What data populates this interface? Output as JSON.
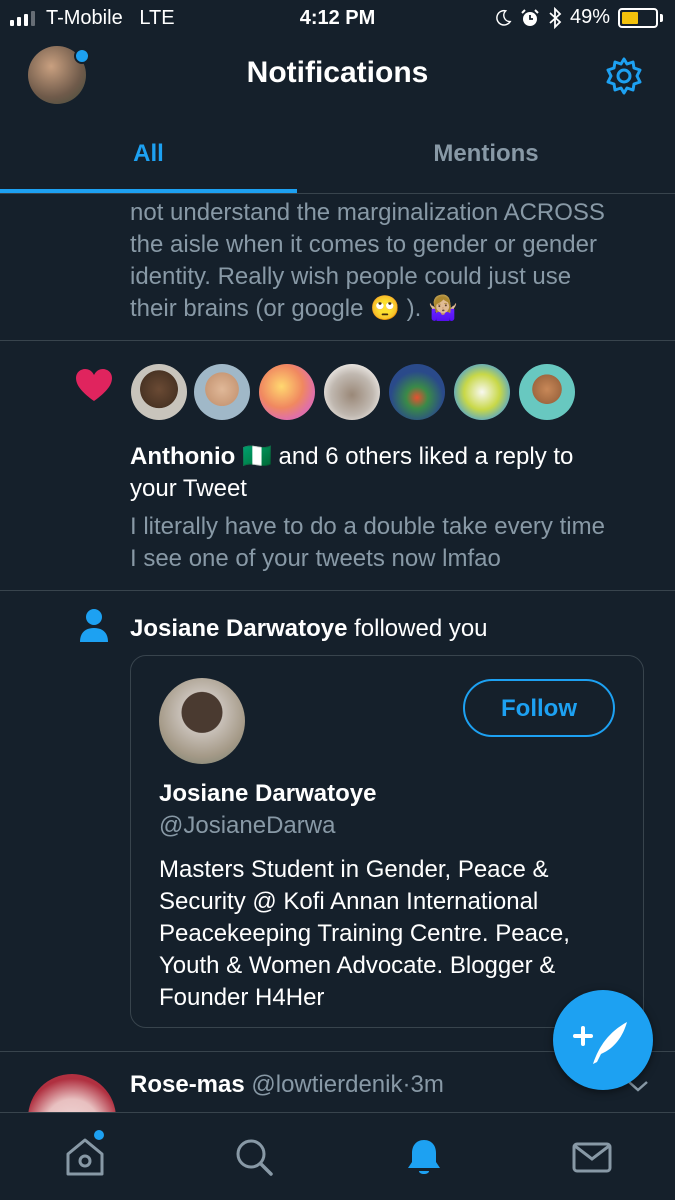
{
  "status_bar": {
    "carrier": "T-Mobile",
    "network": "LTE",
    "time": "4:12 PM",
    "battery": "49%",
    "battery_level": 0.49,
    "icons": [
      "signal-bars-icon",
      "moon-icon",
      "alarm-icon",
      "bluetooth-icon",
      "battery-icon"
    ]
  },
  "header": {
    "title": "Notifications",
    "settings_icon": "gear-icon"
  },
  "tabs": [
    {
      "label": "All",
      "active": true
    },
    {
      "label": "Mentions",
      "active": false
    }
  ],
  "notifications": {
    "first_tweet_tail": [
      "not understand the marginalization ACROSS",
      "the aisle when it comes to gender or gender",
      "identity. Really wish people could just use",
      "their brains (or google 🙄 ). 🤷🏼‍♀️"
    ],
    "like": {
      "icon": "heart-icon",
      "name": "Anthonio",
      "flag": "🇳🇬",
      "text_line1": " and 6 others liked a reply to",
      "text_line2": "your Tweet",
      "preview_line1": "I literally have to do a double take every time",
      "preview_line2": "I see one of your tweets now lmfao",
      "avatar_colors": [
        "#5a4636",
        "#c9a78a",
        "#e8a070",
        "#b8b0a8",
        "#2a4a8a",
        "#c8d848",
        "#68c8c0"
      ]
    },
    "follow": {
      "icon": "person-icon",
      "name": "Josiane Darwatoye",
      "action": " followed you",
      "card": {
        "name": "Josiane Darwatoye",
        "handle": "@JosianeDarwa",
        "follow_label": "Follow",
        "bio_lines": [
          "Masters Student in Gender, Peace &",
          "Security @ Kofi Annan International",
          "Peacekeeping Training Centre. Peace,",
          "Youth & Women Advocate. Blogger &",
          "Founder H4Her"
        ]
      }
    },
    "next": {
      "name": "Rose-mas",
      "handle": "@lowtierdenik",
      "separator": "·",
      "age": "3m"
    }
  },
  "compose_icon": "compose-tweet-icon",
  "bottom_nav": [
    {
      "name": "home-icon",
      "active": false,
      "badge": true
    },
    {
      "name": "search-icon",
      "active": false
    },
    {
      "name": "bell-icon",
      "active": true
    },
    {
      "name": "mail-icon",
      "active": false
    }
  ],
  "colors": {
    "background": "#15202b",
    "accent": "#1da1f2",
    "muted": "#8899a6",
    "divider": "#38444d",
    "heart": "#e0245e"
  }
}
